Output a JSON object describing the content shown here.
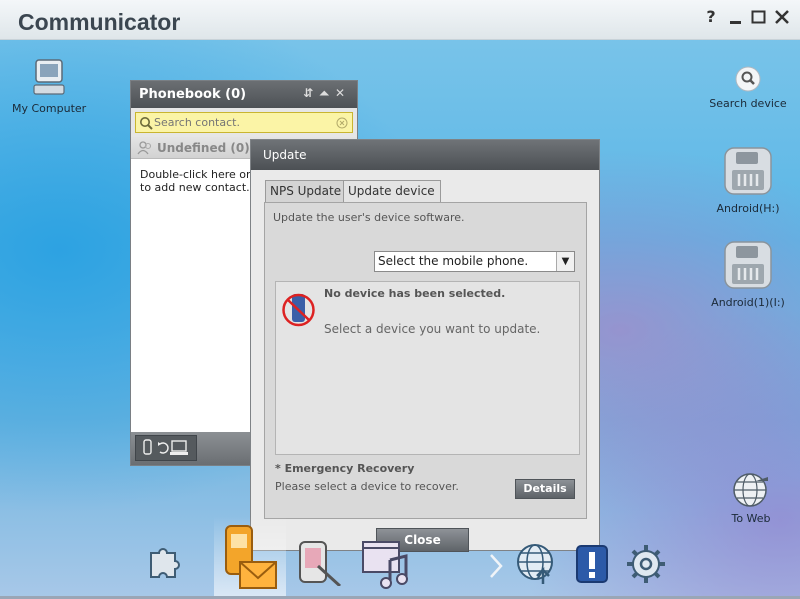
{
  "app": {
    "title": "Communicator"
  },
  "window_controls": {
    "help": "?",
    "minimize": "–",
    "maximize": "□",
    "close": "✕"
  },
  "desktop": {
    "my_computer": "My Computer",
    "search_device": "Search device",
    "android_h": "Android(H:)",
    "android_i": "Android(1)(I:)",
    "to_web": "To Web"
  },
  "phonebook": {
    "title": "Phonebook (0)",
    "search_placeholder": "Search contact.",
    "group": "Undefined (0)",
    "hint_line1": "Double-click here or click",
    "hint_line2": "to add new contact."
  },
  "update": {
    "title": "Update",
    "tabs": [
      "NPS Update",
      "Update device"
    ],
    "description": "Update the user's device software.",
    "select_value": "Select the mobile phone.",
    "no_device_title": "No device has been selected.",
    "no_device_sub": "Select a device you want to update.",
    "emergency_title": "* Emergency Recovery",
    "emergency_sub": "Please select a device to recover.",
    "details_label": "Details",
    "close_label": "Close"
  },
  "dock": [
    "puzzle-icon",
    "phone-message-icon",
    "phone-edit-icon",
    "media-icon",
    "chevron-right-icon",
    "globe-icon",
    "alert-icon",
    "settings-icon"
  ]
}
